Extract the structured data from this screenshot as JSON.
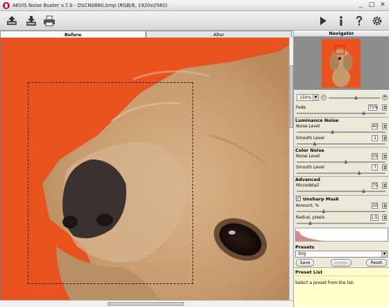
{
  "window": {
    "title": "AKVIS Noise Buster v.7.0 - DSCN0880.bmp (RGB/8, 1920x2560)",
    "controls": [
      "_",
      "□",
      "✕"
    ]
  },
  "toolbar": {
    "left_icons": [
      "open-icon",
      "save-icon",
      "print-icon"
    ],
    "right_icons": [
      "run-icon",
      "info-icon",
      "help-icon",
      "settings-icon"
    ]
  },
  "tabs": [
    {
      "label": "Before",
      "active": true
    },
    {
      "label": "After",
      "active": false
    }
  ],
  "navigator": {
    "title": "Navigator",
    "zoom": "150%",
    "zoom_out": "−",
    "zoom_in": "+"
  },
  "params": {
    "fade": {
      "label": "Fade",
      "value": "75%",
      "level": 0.75
    },
    "luminance": {
      "title": "Luminance Noise",
      "noise": {
        "label": "Noise Level",
        "value": "40",
        "level": 0.4
      },
      "smooth": {
        "label": "Smooth Level",
        "value": "2",
        "level": 0.2
      }
    },
    "color": {
      "title": "Color Noise",
      "noise": {
        "label": "Noise Level",
        "value": "55",
        "level": 0.55
      },
      "smooth": {
        "label": "Smooth Level",
        "value": "7",
        "level": 0.7
      }
    },
    "advanced": {
      "title": "Advanced",
      "micro": {
        "label": "Microdetail",
        "value": "75",
        "level": 0.75
      }
    },
    "unsharp": {
      "title": "Unsharp Mask",
      "checked": true,
      "amount": {
        "label": "Amount, %",
        "value": "30",
        "level": 0.3
      },
      "radius": {
        "label": "Radius, pixels",
        "value": "1,5",
        "level": 0.15
      }
    }
  },
  "presets": {
    "title": "Presets",
    "selected": "dog",
    "save": "Save",
    "delete": "Delete",
    "reset": "Reset"
  },
  "preset_list": {
    "title": "Preset List",
    "text": "Select a preset from the list."
  },
  "colors": {
    "background": "#e8521f",
    "dog_fur": "#c9a37a",
    "nose": "#3a3130"
  }
}
